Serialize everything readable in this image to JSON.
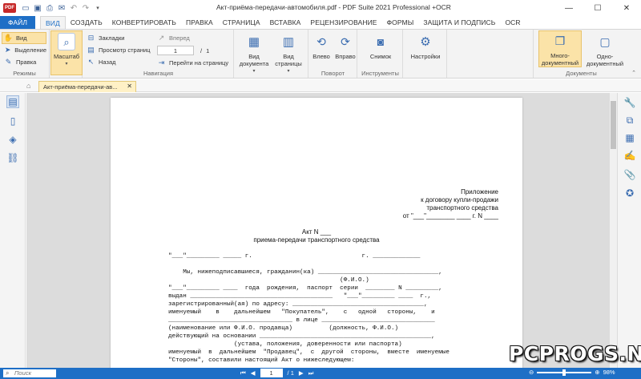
{
  "titlebar": {
    "logo": "PDF",
    "title": "Акт-приёма-передачи-автомобиля.pdf   -   PDF Suite 2021 Professional +OCR"
  },
  "ribbon_tabs": [
    "ФАЙЛ",
    "ВИД",
    "СОЗДАТЬ",
    "КОНВЕРТИРОВАТЬ",
    "ПРАВКА",
    "СТРАНИЦА",
    "ВСТАВКА",
    "РЕЦЕНЗИРОВАНИЕ",
    "ФОРМЫ",
    "ЗАЩИТА И ПОДПИСЬ",
    "OCR"
  ],
  "ribbon": {
    "modes": {
      "items": [
        "Вид",
        "Выделение",
        "Правка"
      ],
      "label": "Режимы"
    },
    "zoom_label": "Масштаб",
    "navigation": {
      "bookmarks": "Закладки",
      "page_view": "Просмотр страниц",
      "back": "Назад",
      "forward": "Вперед",
      "page_value": "1",
      "page_total": "1",
      "goto_page": "Перейти на страницу",
      "label": "Навигация"
    },
    "view": {
      "doc_view": "Вид документа",
      "page_view": "Вид страницы"
    },
    "rotate": {
      "left": "Влево",
      "right": "Вправо",
      "label": "Поворот"
    },
    "tools": {
      "snapshot": "Снимок",
      "label": "Инструменты"
    },
    "settings": "Настройки",
    "documents": {
      "multi": "Много-документный",
      "single": "Одно-документный",
      "label": "Документы"
    }
  },
  "doc_tab": {
    "label": "Акт-приёма-передачи-ав..."
  },
  "document": {
    "appendix": [
      "Приложение",
      "к договору купли-продажи",
      "транспортного средства",
      "от \"___\"________ ____ г. N ____"
    ],
    "title1": "Акт N ___",
    "title2": "приема-передачи транспортного средства",
    "lines": [
      "\"___\"_________ _____ г.                              г. _____________",
      "",
      "    Мы, нижеподписавшиеся, гражданин(ка) _________________________________,",
      "                                               (Ф.И.О.)",
      "\"___\"_________ ____  года  рождения,  паспорт  серии  ________ N _________,",
      "выдан _______________________________________   \"___\"_________ ____  г.,",
      "зарегистрированный(ая) по адресу: ____________________________________,",
      "именуемый    в    дальнейшем   \"Покупатель\",    с   одной   стороны,    и",
      "__________________________________ в лице _______________________________",
      "(наименование или Ф.И.О. продавца)          (должность, Ф.И.О.)",
      "действующий на основании _______________________________________________,",
      "                  (устава, положения, доверенности или паспорта)",
      "именуемый  в  дальнейшем  \"Продавец\",  с  другой  стороны,  вместе  именуемые",
      "\"Стороны\", составили настоящий Акт о нижеследующем:"
    ]
  },
  "statusbar": {
    "search_placeholder": "Поиск",
    "page_value": "1",
    "page_total": "/ 1",
    "zoom": "98%"
  },
  "watermark": "PCPROGS.NET",
  "colors": {
    "accent": "#1e6fc6",
    "doc_tab": "#fff1c6",
    "ribbon_bg": "#f3f3f3"
  }
}
